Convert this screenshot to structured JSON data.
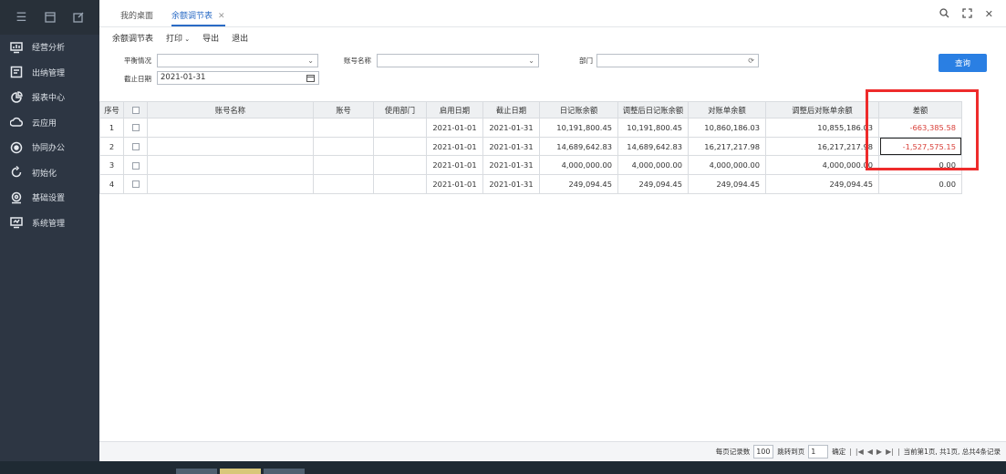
{
  "sidebar": {
    "items": [
      {
        "label": "经营分析",
        "icon": "monitor-chart-icon"
      },
      {
        "label": "出纳管理",
        "icon": "cashier-icon"
      },
      {
        "label": "报表中心",
        "icon": "pie-chart-icon"
      },
      {
        "label": "云应用",
        "icon": "cloud-icon"
      },
      {
        "label": "协同办公",
        "icon": "collaboration-icon"
      },
      {
        "label": "初始化",
        "icon": "refresh-icon"
      },
      {
        "label": "基础设置",
        "icon": "settings-icon"
      },
      {
        "label": "系统管理",
        "icon": "system-monitor-icon"
      }
    ]
  },
  "tabs": [
    {
      "label": "我的桌面"
    },
    {
      "label": "余额调节表"
    }
  ],
  "toolbar": {
    "items": [
      "余额调节表",
      "打印",
      "导出",
      "退出"
    ]
  },
  "filters": {
    "balance_label": "平衡情况",
    "balance_value": "",
    "account_name_label": "账号名称",
    "account_name_value": "",
    "dept_label": "部门",
    "dept_value": "",
    "end_date_label": "截止日期",
    "end_date_value": "2021-01-31",
    "query_button": "查询"
  },
  "table": {
    "headers": [
      "序号",
      "",
      "账号名称",
      "账号",
      "使用部门",
      "启用日期",
      "截止日期",
      "日记账余额",
      "调整后日记账余额",
      "对账单余额",
      "调整后对账单余额",
      "差额"
    ],
    "rows": [
      {
        "no": "1",
        "start": "2021-01-01",
        "end": "2021-01-31",
        "journal": "10,191,800.45",
        "adj_journal": "10,191,800.45",
        "statement": "10,860,186.03",
        "adj_statement": "10,855,186.03",
        "diff": "-663,385.58"
      },
      {
        "no": "2",
        "start": "2021-01-01",
        "end": "2021-01-31",
        "journal": "14,689,642.83",
        "adj_journal": "14,689,642.83",
        "statement": "16,217,217.98",
        "adj_statement": "16,217,217.98",
        "diff": "-1,527,575.15"
      },
      {
        "no": "3",
        "start": "2021-01-01",
        "end": "2021-01-31",
        "journal": "4,000,000.00",
        "adj_journal": "4,000,000.00",
        "statement": "4,000,000.00",
        "adj_statement": "4,000,000.00",
        "diff": "0.00"
      },
      {
        "no": "4",
        "start": "2021-01-01",
        "end": "2021-01-31",
        "journal": "249,094.45",
        "adj_journal": "249,094.45",
        "statement": "249,094.45",
        "adj_statement": "249,094.45",
        "diff": "0.00"
      }
    ]
  },
  "pager": {
    "per_page_label": "每页记录数",
    "per_page_value": "100",
    "jump_label": "跳转到页",
    "jump_value": "1",
    "confirm": "确定",
    "status": "当前第1页, 共1页, 总共4条记录"
  },
  "colors": {
    "sidebar_bg": "#2d3643",
    "accent": "#2a7fe3",
    "negative": "#d9413a",
    "highlight": "#ee2b2b"
  }
}
